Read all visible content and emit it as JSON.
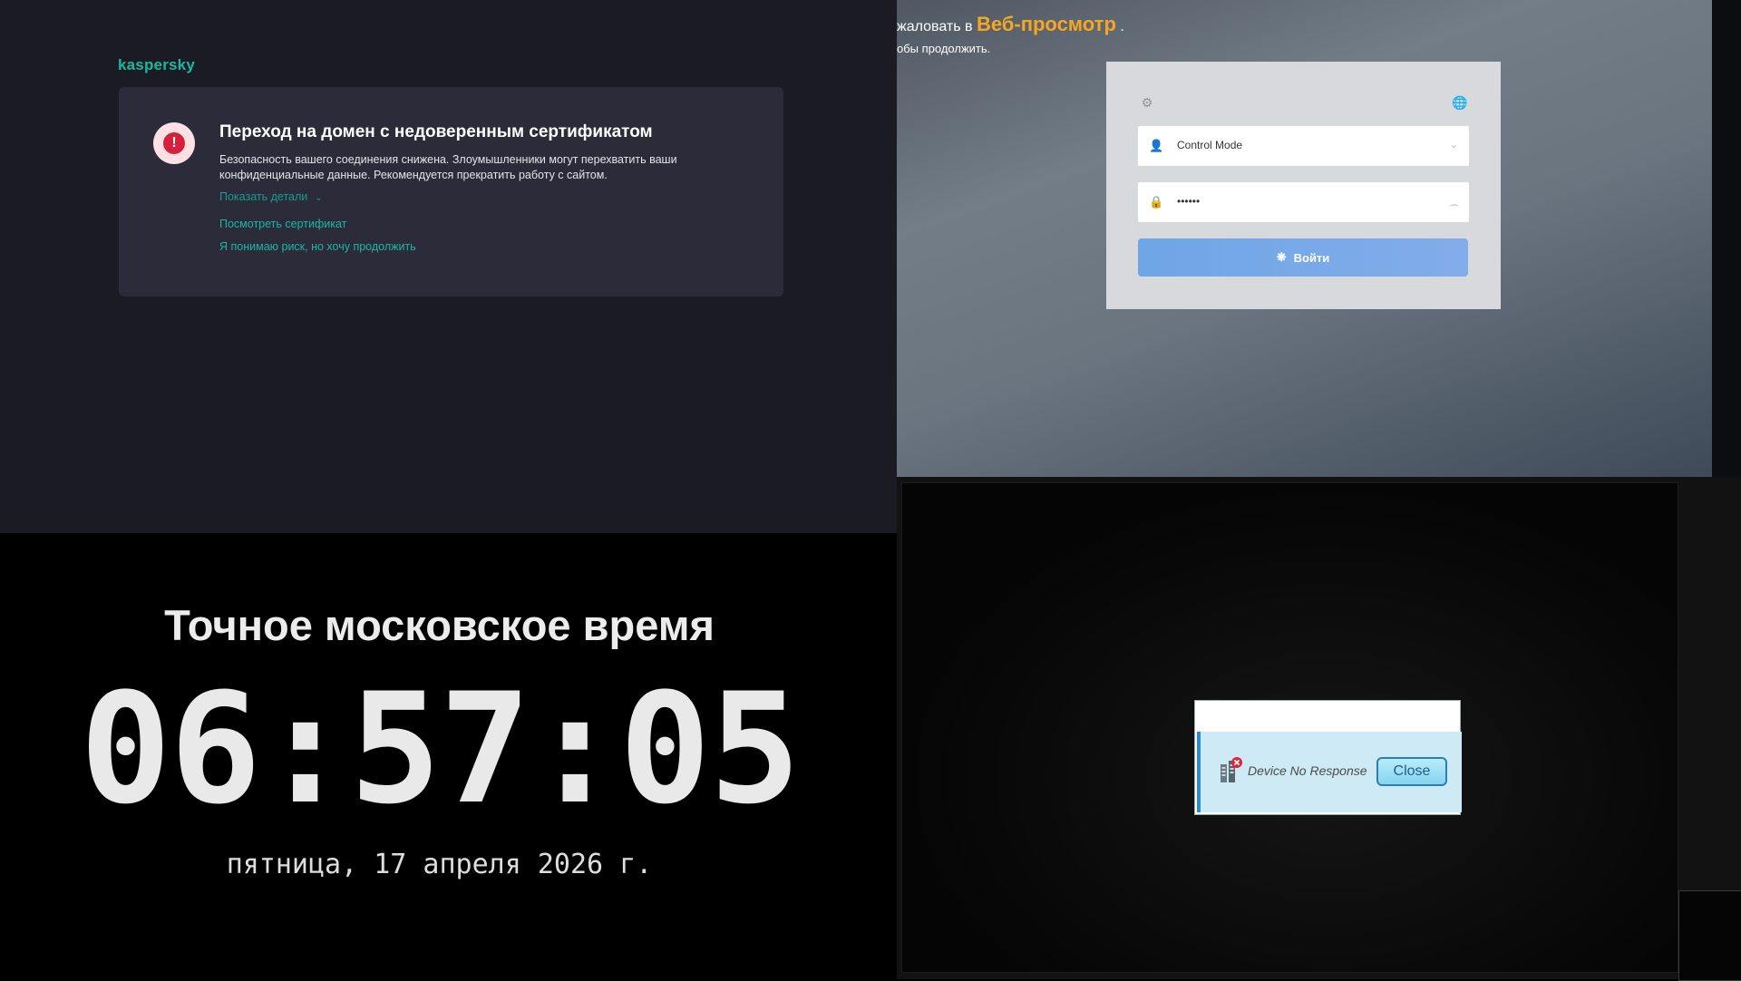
{
  "kaspersky": {
    "logo": "kaspersky",
    "title": "Переход на домен с недоверенным сертификатом",
    "description": "Безопасность вашего соединения снижена. Злоумышленники могут перехватить ваши конфиденциальные данные. Рекомендуется прекратить работу с сайтом.",
    "show_details": "Показать детали",
    "view_certificate": "Посмотреть сертификат",
    "continue_risk": "Я понимаю риск, но хочу продолжить",
    "alert_color": "#d6203b",
    "accent_color": "#19b9a1"
  },
  "webview": {
    "welcome_prefix": "жаловать в",
    "brand": "Веб-просмотр",
    "welcome_suffix": ".",
    "subtitle": "обы продолжить.",
    "mode_value": "Control Mode",
    "password_mask": "••••••",
    "login_label": "Войти",
    "icons": [
      "gear-icon",
      "globe-icon",
      "user-icon",
      "lock-icon",
      "chevron-down-icon",
      "eye-closed-icon",
      "spinner-icon"
    ]
  },
  "clock": {
    "heading": "Точное московское время",
    "time": "06:57:05",
    "date": "пятница, 17 апреля 2026 г."
  },
  "device": {
    "message": "Device No Response",
    "close_label": "Close"
  }
}
